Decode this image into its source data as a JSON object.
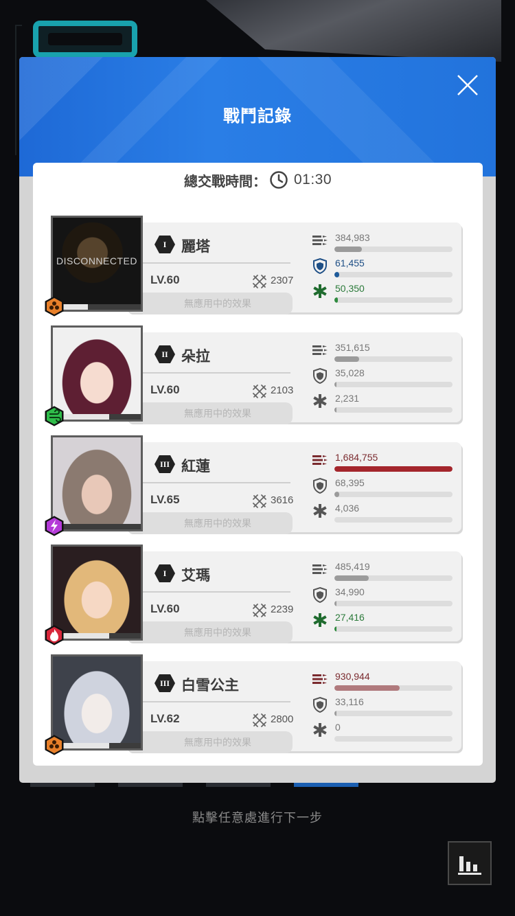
{
  "dialog": {
    "title": "戰鬥記錄",
    "battle_time_label": "總交戰時間：",
    "battle_time_value": "01:30"
  },
  "colors": {
    "header_blue": "#2273dc",
    "damage_bar": "#9b9b9b",
    "damage_bar_top": "#a4262c",
    "damage_bar_top_light": "#b07a7d",
    "defense_bar": "#9b9b9b",
    "defense_bar_top": "#1e5b9a",
    "heal_bar_green": "#2f8b3f",
    "heal_bar_gray": "#9b9b9b"
  },
  "characters": [
    {
      "rank": "I",
      "name": "麗塔",
      "level": "LV.60",
      "power": "2307",
      "effect": "無應用中的效果",
      "status": "DISCONNECTED",
      "element": "hexagon-element-icon",
      "hp": 0.4,
      "damage": "384,983",
      "damage_ratio": 0.23,
      "defense": "61,455",
      "defense_ratio": 0.04,
      "heal": "50,350",
      "heal_ratio": 0.03
    },
    {
      "rank": "II",
      "name": "朵拉",
      "level": "LV.60",
      "power": "2103",
      "effect": "無應用中的效果",
      "status": "",
      "element": "wind-element-icon",
      "hp": 0.64,
      "damage": "351,615",
      "damage_ratio": 0.21,
      "defense": "35,028",
      "defense_ratio": 0.02,
      "heal": "2,231",
      "heal_ratio": 0.01
    },
    {
      "rank": "III",
      "name": "紅蓮",
      "level": "LV.65",
      "power": "3616",
      "effect": "無應用中的效果",
      "status": "",
      "element": "lightning-element-icon",
      "hp": 0.08,
      "damage": "1,684,755",
      "damage_ratio": 1.0,
      "defense": "68,395",
      "defense_ratio": 0.04,
      "heal": "4,036",
      "heal_ratio": 0.0
    },
    {
      "rank": "I",
      "name": "艾瑪",
      "level": "LV.60",
      "power": "2239",
      "effect": "無應用中的效果",
      "status": "",
      "element": "fire-element-icon",
      "hp": 0.64,
      "damage": "485,419",
      "damage_ratio": 0.29,
      "defense": "34,990",
      "defense_ratio": 0.02,
      "heal": "27,416",
      "heal_ratio": 0.02
    },
    {
      "rank": "III",
      "name": "白雪公主",
      "level": "LV.62",
      "power": "2800",
      "effect": "無應用中的效果",
      "status": "",
      "element": "hexagon-element-icon",
      "hp": 0.64,
      "damage": "930,944",
      "damage_ratio": 0.55,
      "defense": "33,116",
      "defense_ratio": 0.02,
      "heal": "0",
      "heal_ratio": 0.0
    }
  ],
  "footer": {
    "hint": "點擊任意處進行下一步"
  }
}
